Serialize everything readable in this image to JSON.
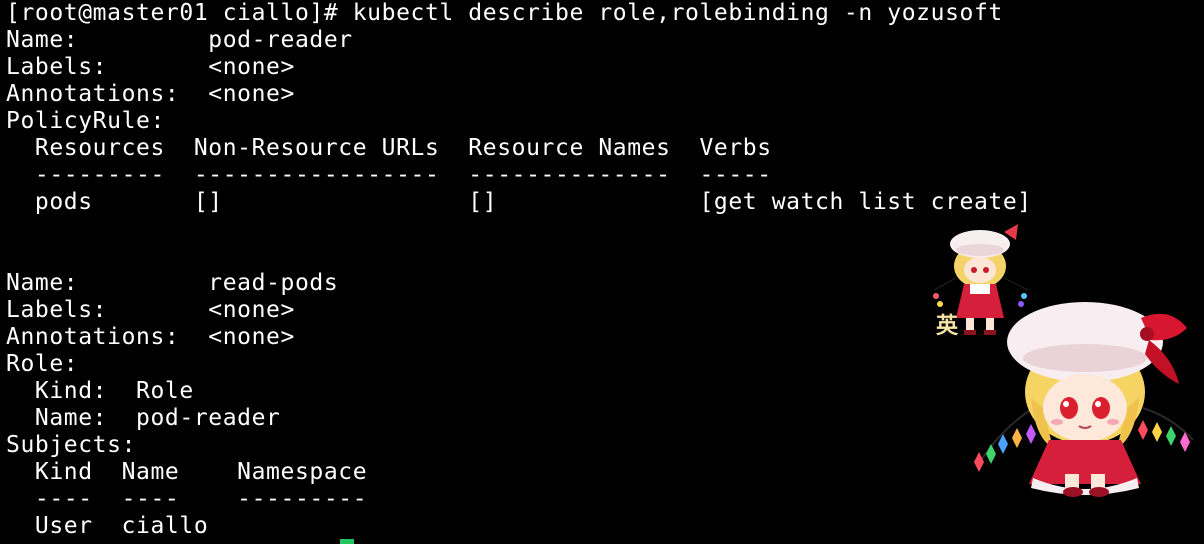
{
  "terminal": {
    "lines": [
      "[root@master01 ciallo]# kubectl describe role,rolebinding -n yozusoft",
      "Name:         pod-reader",
      "Labels:       <none>",
      "Annotations:  <none>",
      "PolicyRule:",
      "  Resources  Non-Resource URLs  Resource Names  Verbs",
      "  ---------  -----------------  --------------  -----",
      "  pods       []                 []              [get watch list create]",
      "",
      "",
      "Name:         read-pods",
      "Labels:       <none>",
      "Annotations:  <none>",
      "Role:",
      "  Kind:  Role",
      "  Name:  pod-reader",
      "Subjects:",
      "  Kind  Name    Namespace",
      "  ----  ----    ---------",
      "  User  ciallo"
    ],
    "cursor_color": "#22c55e"
  },
  "decorations": {
    "mascot_small": "chibi-character-icon",
    "mascot_large": "chibi-character-icon",
    "badge_text": "英"
  }
}
